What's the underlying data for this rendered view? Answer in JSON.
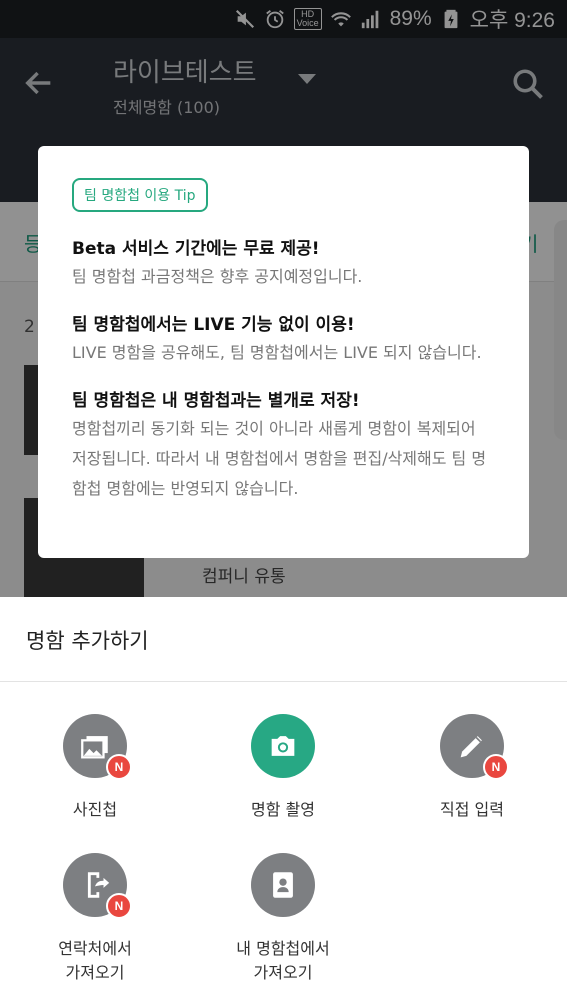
{
  "status_bar": {
    "icons": [
      "mute-icon",
      "alarm-icon",
      "hd-voice-icon",
      "wifi-icon",
      "signal-icon",
      "battery-icon"
    ],
    "hd_label": "HD",
    "voice_label": "Voice",
    "battery": "89%",
    "time": "오후 9:26"
  },
  "app_bar": {
    "title": "라이브테스트",
    "subtitle": "전체명함 (100)"
  },
  "background": {
    "tab_left": "등",
    "tab_right": "기",
    "list_number": "2",
    "company": "컴퍼니 유통"
  },
  "tip": {
    "badge": "팀 명함첩 이용 Tip",
    "items": [
      {
        "heading": "Beta 서비스 기간에는 무료 제공!",
        "body": "팀 명함첩 과금정책은 향후 공지예정입니다."
      },
      {
        "heading": "팀 명함첩에서는 LIVE 기능 없이 이용!",
        "body": "LIVE 명함을 공유해도, 팀 명함첩에서는 LIVE 되지 않습니다."
      },
      {
        "heading": "팀 명함첩은 내 명함첩과는 별개로 저장!",
        "body": "명함첩끼리 동기화 되는 것이 아니라 새롭게 명함이 복제되어 저장됩니다. 따라서 내 명함첩에서 명함을 편집/삭제해도 팀 명함첩 명함에는 반영되지 않습니다."
      }
    ]
  },
  "sheet": {
    "title": "명함 추가하기",
    "new_badge": "N",
    "options": [
      {
        "label": "사진첩",
        "icon": "gallery-icon"
      },
      {
        "label": "명함 촬영",
        "icon": "camera-icon"
      },
      {
        "label": "직접 입력",
        "icon": "pencil-icon"
      },
      {
        "label": "연락처에서\n가져오기",
        "icon": "import-contacts-icon"
      },
      {
        "label": "내 명함첩에서\n가져오기",
        "icon": "contact-card-icon"
      }
    ]
  },
  "colors": {
    "accent_green": "#27a884",
    "new_badge_red": "#e9473f",
    "icon_gray": "#7d7f82"
  }
}
